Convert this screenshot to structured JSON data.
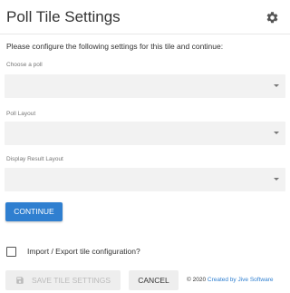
{
  "header": {
    "title": "Poll Tile Settings",
    "settings_icon": "gear-icon"
  },
  "intro_text": "Please configure the following settings for this tile and continue:",
  "fields": [
    {
      "label": "Choose a poll",
      "value": ""
    },
    {
      "label": "Poll Layout",
      "value": ""
    },
    {
      "label": "Display Result Layout",
      "value": ""
    }
  ],
  "continue_label": "CONTINUE",
  "import_export": {
    "label": "Import / Export tile configuration?",
    "checked": false
  },
  "footer": {
    "save_label": "SAVE TILE SETTINGS",
    "save_icon": "save-icon",
    "cancel_label": "CANCEL",
    "copyright_prefix": "© 2020",
    "copyright_link": "Created by Jive Software"
  },
  "colors": {
    "accent": "#2f7fd0",
    "field_bg": "#f2f2f2",
    "button_bg": "#eeeeee",
    "disabled_text": "#bbbbbb"
  }
}
